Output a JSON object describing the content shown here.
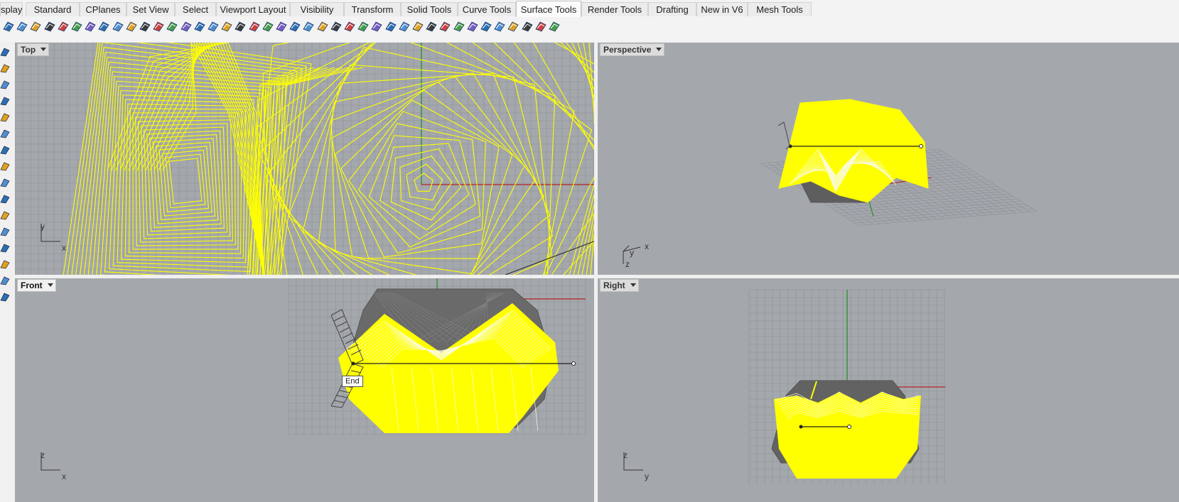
{
  "ribbon": {
    "tabs": [
      {
        "label": "splay",
        "active": false
      },
      {
        "label": "Standard",
        "active": false
      },
      {
        "label": "CPlanes",
        "active": false
      },
      {
        "label": "Set View",
        "active": false
      },
      {
        "label": "Select",
        "active": false
      },
      {
        "label": "Viewport Layout",
        "active": false
      },
      {
        "label": "Visibility",
        "active": false
      },
      {
        "label": "Transform",
        "active": false
      },
      {
        "label": "Solid Tools",
        "active": false
      },
      {
        "label": "Curve Tools",
        "active": false
      },
      {
        "label": "Surface Tools",
        "active": true
      },
      {
        "label": "Render Tools",
        "active": false
      },
      {
        "label": "Drafting",
        "active": false
      },
      {
        "label": "New in V6",
        "active": false
      },
      {
        "label": "Mesh Tools",
        "active": false
      }
    ]
  },
  "toolbar": {
    "icons": [
      "surface-from-curves-icon",
      "extrude-icon",
      "loft-icon",
      "sweep-icon",
      "revolve-icon",
      "patch-icon",
      "network-icon",
      "edge-icon",
      "blend-icon",
      "offset-icon",
      "fillet-icon",
      "chamfer-icon",
      "rebuild-icon",
      "match-icon",
      "merge-icon",
      "split-icon",
      "trim-icon",
      "untrim-icon",
      "unroll-icon",
      "fit-icon",
      "deg-icon",
      "flatten-icon",
      "shrink-icon",
      "zebra-icon",
      "curvature-icon",
      "draft-icon",
      "environment-icon",
      "point-icon",
      "select-icon",
      "pipe-icon",
      "rail-icon",
      "flow-icon",
      "deform-icon",
      "splop-icon",
      "twist-icon",
      "bend-icon",
      "analysis-icon",
      "color-icon",
      "uv-icon",
      "dimension-icon",
      "grid-icon"
    ]
  },
  "left_tools": {
    "icons": [
      "polyline-icon",
      "curve-icon",
      "arc-icon",
      "rectangle-icon",
      "circle-icon",
      "surface-icon",
      "box-icon",
      "plane-icon",
      "extrude-icon",
      "mesh-icon",
      "transform-icon",
      "cone-icon",
      "sphere-icon",
      "torus-icon",
      "dome-icon",
      "array-icon"
    ]
  },
  "colors": {
    "viewport_bg": "#a4a8ad",
    "grid": "#8d9196",
    "wire_yellow": "#ffff00",
    "wire_gray": "#6e6e6e",
    "axis_red": "#b22222",
    "axis_green": "#1e8c1e"
  },
  "viewports": {
    "top": {
      "label": "Top",
      "axis_u": "x",
      "axis_v": "y",
      "active": false
    },
    "perspective": {
      "label": "Perspective",
      "axis_x": "x",
      "axis_y": "y",
      "axis_z": "z",
      "active": false
    },
    "front": {
      "label": "Front",
      "axis_u": "x",
      "axis_v": "z",
      "active": true,
      "tooltip": "End"
    },
    "right": {
      "label": "Right",
      "axis_u": "y",
      "axis_v": "z",
      "active": false
    }
  }
}
